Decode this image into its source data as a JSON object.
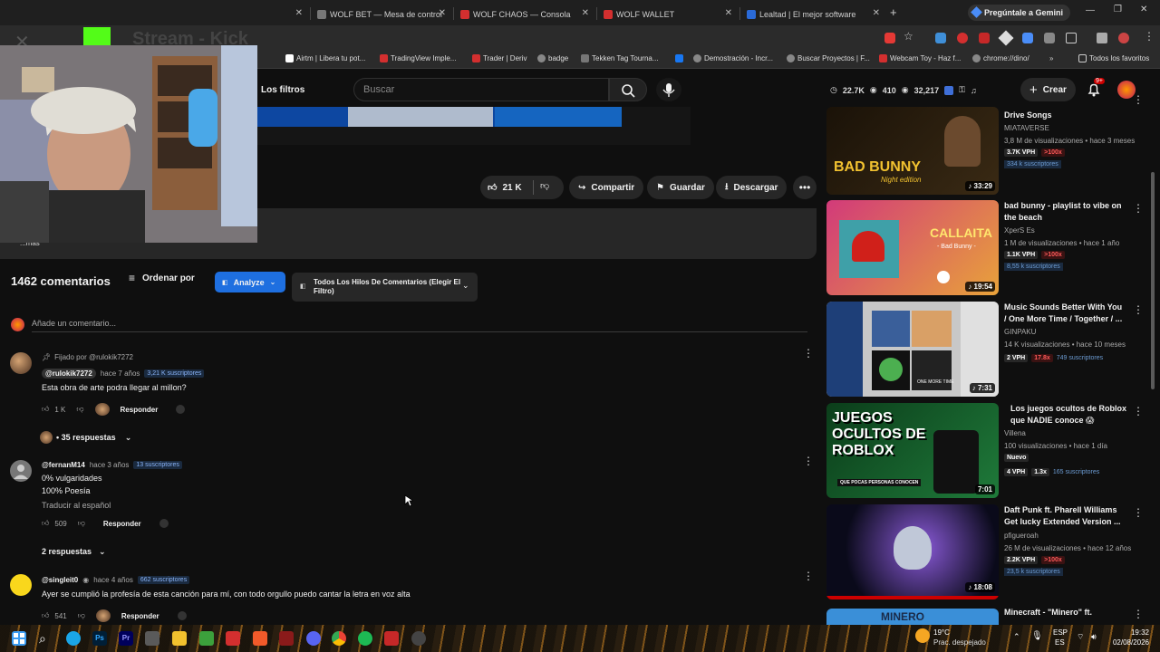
{
  "browser": {
    "tabs": [
      {
        "label": "WOLF BET — Mesa de control",
        "color": "#777"
      },
      {
        "label": "WOLF CHAOS — Consola",
        "color": "#d32f2f"
      },
      {
        "label": "WOLF WALLET",
        "color": "#d32f2f"
      },
      {
        "label": "Lealtad | El mejor software para",
        "color": "#2a6ad8"
      }
    ],
    "gemini_label": "Pregúntale a Gemini",
    "bookmarks": [
      {
        "label": "Airtm | Libera tu pot...",
        "color": "#fff"
      },
      {
        "label": "TradingView Imple...",
        "color": "#d32f2f"
      },
      {
        "label": "Trader | Deriv",
        "color": "#d32f2f"
      },
      {
        "label": "badge",
        "color": "#888"
      },
      {
        "label": "Tekken Tag Tourna...",
        "color": "#888"
      },
      {
        "label": "Demostración - Incr...",
        "color": "#888"
      },
      {
        "label": "Buscar Proyectos | F...",
        "color": "#888"
      },
      {
        "label": "Webcam Toy - Haz f...",
        "color": "#d32f2f"
      },
      {
        "label": "chrome://dino/",
        "color": "#888"
      }
    ],
    "all_favorites": "Todos los favoritos"
  },
  "header": {
    "filters_label": "Los filtros",
    "search_placeholder": "Buscar",
    "stats": {
      "a": "22.7K",
      "b": "410",
      "c": "32,217"
    },
    "create_label": "Crear",
    "notif_badge": "9+"
  },
  "video_actions": {
    "likes": "21 K",
    "share": "Compartir",
    "save": "Guardar",
    "download": "Descargar"
  },
  "description_more": "...más",
  "comments": {
    "count_label": "1462 comentarios",
    "sort_label": "Ordenar por",
    "analyze_label": "Analyze",
    "filter_label": "Todos Los Hilos De Comentarios (Elegir El Filtro)",
    "add_placeholder": "Añade un comentario...",
    "items": [
      {
        "pinned": "Fijado por @rulokik7272",
        "author": "@rulokik7272",
        "time": "hace 7 años",
        "subs": "3,21 K suscriptores",
        "text": "Esta obra de arte podra llegar al millon?",
        "likes": "1 K",
        "reply": "Responder",
        "replies": "• 35 respuestas"
      },
      {
        "author": "@fernanM14",
        "time": "hace 3 años",
        "subs": "13 suscriptores",
        "text1": "0% vulgaridades",
        "text2": "100% Poesía",
        "translate": "Traducir al español",
        "likes": "509",
        "reply": "Responder",
        "replies": "2 respuestas"
      },
      {
        "author": "@singleit0",
        "time": "hace 4 años",
        "subs": "662 suscriptores",
        "text": "Ayer se cumplió la profesía de esta canción para mí, con todo orgullo puedo cantar la letra en voz alta",
        "likes": "541",
        "reply": "Responder"
      }
    ]
  },
  "related": [
    {
      "title_line": "Drive Songs",
      "channel": "MIATAVERSE",
      "views": "3,8 M de visualizaciones • hace 3 meses",
      "vph": "3.7K VPH",
      "badge": ">100x",
      "subs": "334 k suscriptores",
      "duration": "33:29",
      "thumb_text": "BAD BUNNY",
      "thumb_sub": "Night edition"
    },
    {
      "title_line": "bad bunny - playlist to vibe on the beach",
      "channel": "XperS Es",
      "views": "1 M de visualizaciones • hace 1 año",
      "vph": "1.1K VPH",
      "badge": ">100x",
      "subs": "8,55 k suscriptores",
      "duration": "19:54",
      "thumb_text": "CALLAITA",
      "thumb_sub": "- Bad Bunny -"
    },
    {
      "title_line": "Music Sounds Better With You / One More Time / Together / ...",
      "channel": "GINPAKU",
      "views": "14 K visualizaciones • hace 10 meses",
      "vph": "2 VPH",
      "badge": "17.8x",
      "subs": "749 suscriptores",
      "duration": "7:31",
      "thumb_text": "ONE MORE TIME"
    },
    {
      "title_line": "Los juegos ocultos de Roblox que NADIE conoce 😱",
      "channel": "Villena",
      "views": "100 visualizaciones • hace 1 día",
      "new_badge": "Nuevo",
      "vph": "4 VPH",
      "badge": "1.3x",
      "subs": "165 suscriptores",
      "duration": "7:01",
      "thumb_text": "JUEGOS OCULTOS DE ROBLOX",
      "thumb_sub": "QUE POCAS PERSONAS CONOCEN"
    },
    {
      "title_line": "Daft Punk ft. Pharell Williams Get lucky Extended Version ...",
      "channel": "pfiguerоah",
      "views": "26 M de visualizaciones • hace 12 años",
      "vph": "2.2K VPH",
      "badge": ">100x",
      "subs": "23,5 k suscriptores",
      "duration": "18:08"
    },
    {
      "title_line": "Minecraft - \"Minero\" ft.",
      "thumb_text": "MINERO"
    }
  ],
  "webcam_overlay": {
    "label": "Stream - Kick"
  },
  "taskbar": {
    "weather_temp": "19°C",
    "weather_desc": "Prac. despejado",
    "lang": "ESP",
    "lang2": "ES",
    "time": "19:32",
    "date": "02/08/2026"
  }
}
